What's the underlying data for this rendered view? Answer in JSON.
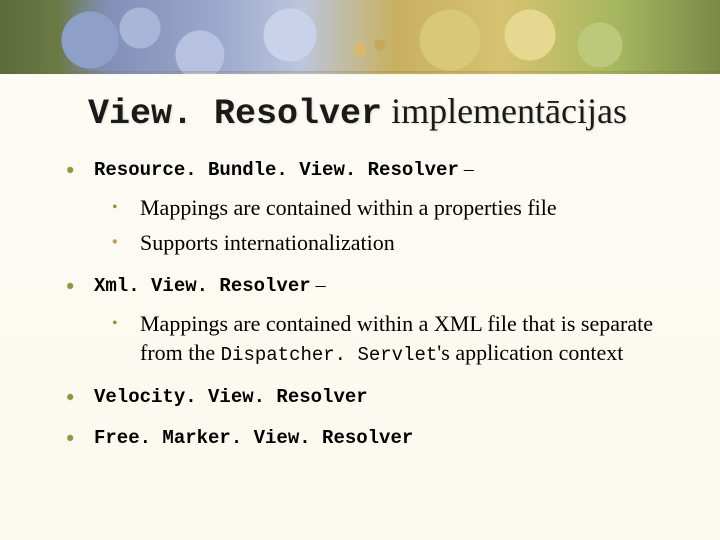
{
  "title": {
    "code": "View. Resolver",
    "rest": " implementācijas"
  },
  "items": [
    {
      "head_code": "Resource. Bundle. View. Resolver",
      "head_suffix": " –",
      "subs": [
        {
          "bullet_style": "green",
          "text": "Mappings are contained within a properties file"
        },
        {
          "bullet_style": "tan",
          "text": "Supports internationalization"
        }
      ]
    },
    {
      "head_code": "Xml. View. Resolver",
      "head_suffix": " –",
      "subs": [
        {
          "bullet_style": "green",
          "text_pre": "Mappings are contained within a XML file that is separate from the ",
          "code": "Dispatcher. Servlet",
          "text_post": "'s application context"
        }
      ]
    },
    {
      "head_code": "Velocity. View. Resolver",
      "head_suffix": ""
    },
    {
      "head_code": "Free. Marker. View. Resolver",
      "head_suffix": ""
    }
  ]
}
